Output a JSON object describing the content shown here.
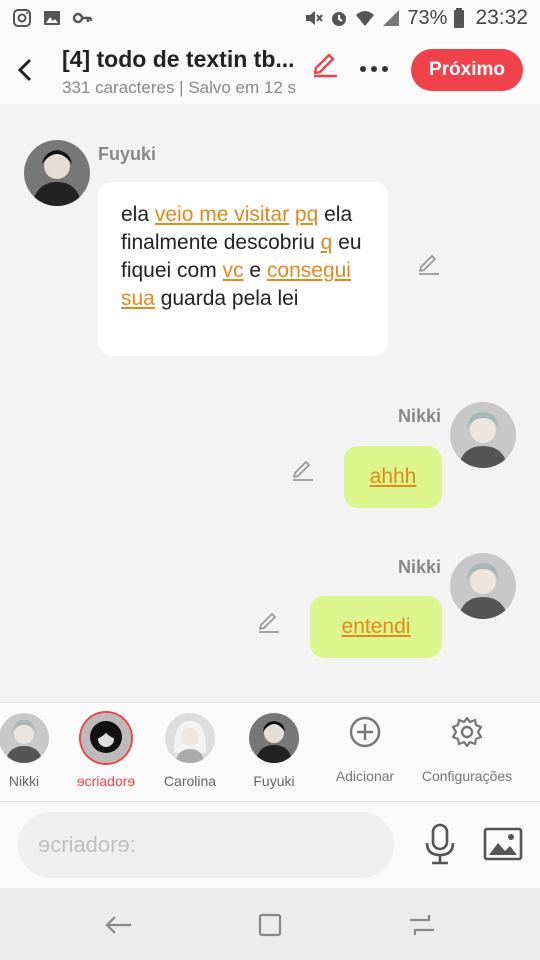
{
  "status_bar": {
    "battery": "73%",
    "time": "23:32"
  },
  "header": {
    "title": "[4] todo de textin tb...",
    "subtitle": "331 caracteres | Salvo em 12 s",
    "next_label": "Próximo"
  },
  "messages": [
    {
      "sender": "Fuyuki",
      "side": "left",
      "segments": [
        {
          "text": "ela ",
          "hl": false
        },
        {
          "text": "veio me visitar",
          "hl": true
        },
        {
          "text": " ",
          "hl": false
        },
        {
          "text": "pq",
          "hl": true
        },
        {
          "text": " ela finalmente descobriu ",
          "hl": false
        },
        {
          "text": "q",
          "hl": true
        },
        {
          "text": " eu fiquei com ",
          "hl": false
        },
        {
          "text": "vc",
          "hl": true
        },
        {
          "text": " e ",
          "hl": false
        },
        {
          "text": "consegui sua",
          "hl": true
        },
        {
          "text": " guarda pela lei",
          "hl": false
        }
      ]
    },
    {
      "sender": "Nikki",
      "side": "right",
      "text": "ahhh"
    },
    {
      "sender": "Nikki",
      "side": "right",
      "text": "entendi"
    }
  ],
  "characters": [
    {
      "name": "Nikki",
      "active": false
    },
    {
      "name": "ɘcriadorɘ",
      "active": true
    },
    {
      "name": "Carolina",
      "active": false
    },
    {
      "name": "Fuyuki",
      "active": false
    }
  ],
  "tools": {
    "add_label": "Adicionar",
    "settings_label": "Configurações"
  },
  "input": {
    "placeholder": "ɘcriadorɘ:"
  },
  "colors": {
    "accent": "#f0424b",
    "bubble_right": "#dcf58c",
    "link": "#e08a1e"
  }
}
